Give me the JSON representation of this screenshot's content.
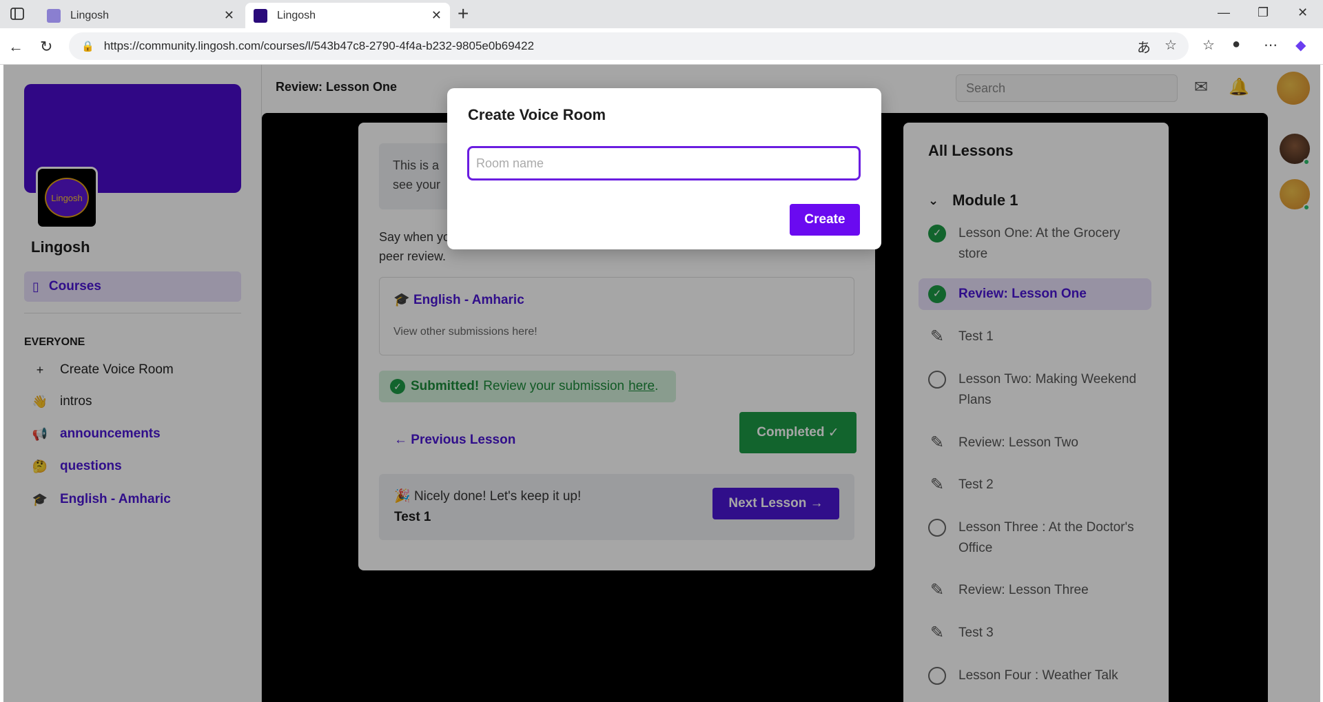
{
  "browser": {
    "tabs": [
      {
        "label": "Lingosh",
        "active": false
      },
      {
        "label": "Lingosh",
        "active": true
      }
    ],
    "url": "https://community.lingosh.com/courses/l/543b47c8-2790-4f4a-b232-9805e0b69422"
  },
  "sidebar": {
    "community_name": "Lingosh",
    "logo_text": "Lingosh",
    "courses_label": "Courses",
    "section_title": "EVERYONE",
    "items": [
      {
        "label": "Create Voice Room",
        "icon": "plus-icon"
      },
      {
        "label": "intros",
        "icon": "waving-hand-icon"
      },
      {
        "label": "announcements",
        "icon": "megaphone-icon"
      },
      {
        "label": "questions",
        "icon": "thinking-face-icon"
      },
      {
        "label": "English - Amharic",
        "icon": "graduation-cap-icon"
      }
    ]
  },
  "header": {
    "title": "Review: Lesson One",
    "search_placeholder": "Search"
  },
  "lesson": {
    "info_text_1": "This is a",
    "info_text_2": "see your",
    "say_text_1": "Say when yo",
    "say_text_2": "peer review.",
    "course_title": "English - Amharic",
    "course_sub": "View other submissions here!",
    "submitted_bold": "Submitted!",
    "submitted_text": "Review your submission",
    "submitted_link": "here",
    "previous_label": "Previous Lesson",
    "completed_label": "Completed",
    "next_message": "Nicely done! Let's keep it up!",
    "next_lesson_title": "Test 1",
    "next_button": "Next Lesson"
  },
  "lessons_panel": {
    "title": "All Lessons",
    "module": "Module 1",
    "items": [
      {
        "label": "Lesson One: At the Grocery store",
        "status": "done"
      },
      {
        "label": "Review: Lesson One",
        "status": "current"
      },
      {
        "label": "Test 1",
        "status": "test"
      },
      {
        "label": "Lesson Two: Making Weekend Plans",
        "status": "todo"
      },
      {
        "label": "Review: Lesson Two",
        "status": "test"
      },
      {
        "label": "Test 2",
        "status": "test"
      },
      {
        "label": "Lesson Three : At the Doctor's Office",
        "status": "todo"
      },
      {
        "label": "Review: Lesson Three",
        "status": "test"
      },
      {
        "label": "Test 3",
        "status": "test"
      },
      {
        "label": "Lesson Four : Weather Talk",
        "status": "todo"
      }
    ]
  },
  "modal": {
    "title": "Create Voice Room",
    "input_placeholder": "Room name",
    "input_value": "",
    "create_label": "Create"
  },
  "colors": {
    "brand": "#4a16d4",
    "success": "#1d9a45",
    "modal_accent": "#6a0af0"
  }
}
